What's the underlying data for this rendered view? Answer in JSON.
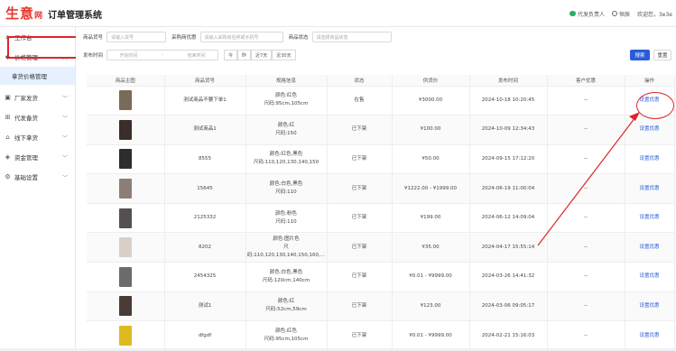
{
  "header": {
    "logo_main": "生意",
    "logo_sub": "网",
    "title": "订单管理系统",
    "agent_label": "代发负责人",
    "account_label": "恒辰",
    "welcome": "欢迎您，3e3e"
  },
  "sidebar": {
    "items": [
      {
        "label": "工作台",
        "icon": "home-icon"
      },
      {
        "label": "价格管理",
        "icon": "tag-icon",
        "expanded": true
      },
      {
        "label": "厂家发货",
        "icon": "box-icon"
      },
      {
        "label": "代发备货",
        "icon": "cart-icon"
      },
      {
        "label": "线下拿货",
        "icon": "store-icon"
      },
      {
        "label": "资金管理",
        "icon": "wallet-icon"
      },
      {
        "label": "基础设置",
        "icon": "gear-icon"
      }
    ],
    "active_sub": "拿货价格管理"
  },
  "filters": {
    "goods_no_label": "商品货号",
    "goods_no_placeholder": "请输入货号",
    "buyer_label": "采购商优惠",
    "buyer_placeholder": "请输入采购商名称或手机号",
    "status_label": "商品状态",
    "status_placeholder": "请选择商品状态",
    "time_label": "发布时间",
    "start_placeholder": "开始时间",
    "end_placeholder": "结束时间",
    "range_sep": "-",
    "quick": [
      "今",
      "昨",
      "近7天",
      "近30天"
    ],
    "search_btn": "搜索",
    "reset_btn": "重置"
  },
  "table": {
    "columns": [
      "商品主图",
      "商品货号",
      "规格信息",
      "状态",
      "供货价",
      "发布时间",
      "客户优惠",
      "操作"
    ],
    "rows": [
      {
        "sku": "测试商品不要下单1",
        "spec1": "颜色:红色",
        "spec2": "尺码:95cm,105cm",
        "status": "在售",
        "price": "¥3000.00",
        "time": "2024-10-18 10:20:45",
        "discount": "--",
        "action": "设置优惠",
        "img": "#7a6a58"
      },
      {
        "sku": "测试商品1",
        "spec1": "颜色:红",
        "spec2": "尺码:150",
        "status": "已下架",
        "price": "¥100.00",
        "time": "2024-10-09 12:34:43",
        "discount": "--",
        "action": "设置优惠",
        "img": "#3a2e2a"
      },
      {
        "sku": "8555",
        "spec1": "颜色:红色,黑色",
        "spec2": "尺码:110,120,130,140,150",
        "status": "已下架",
        "price": "¥50.00",
        "time": "2024-09-15 17:12:20",
        "discount": "--",
        "action": "设置优惠",
        "img": "#2d2d2d"
      },
      {
        "sku": "15645",
        "spec1": "颜色:白色,黑色",
        "spec2": "尺码:110",
        "status": "已下架",
        "price": "¥1222.00 - ¥1999.00",
        "time": "2024-06-19 11:00:04",
        "discount": "--",
        "action": "设置优惠",
        "img": "#8c7f78"
      },
      {
        "sku": "2125332",
        "spec1": "颜色:粉色",
        "spec2": "尺码:110",
        "status": "已下架",
        "price": "¥199.00",
        "time": "2024-06-12 14:09:04",
        "discount": "--",
        "action": "设置优惠",
        "img": "#555050"
      },
      {
        "sku": "8202",
        "spec1": "颜色:图片色",
        "spec2": "尺码:110,120,130,140,150,160,...",
        "status": "已下架",
        "price": "¥35.00",
        "time": "2024-04-17 15:55:14",
        "discount": "--",
        "action": "设置优惠",
        "img": "#d8d0c6"
      },
      {
        "sku": "2454325",
        "spec1": "颜色:白色,黑色",
        "spec2": "尺码:120cm,140cm",
        "status": "已下架",
        "price": "¥0.01 - ¥9999.00",
        "time": "2024-03-26 14:41:32",
        "discount": "--",
        "action": "设置优惠",
        "img": "#6b6b6b"
      },
      {
        "sku": "测试1",
        "spec1": "颜色:红",
        "spec2": "尺码:52cm,59cm",
        "status": "已下架",
        "price": "¥123.00",
        "time": "2024-03-06 09:05:17",
        "discount": "--",
        "action": "设置优惠",
        "img": "#4a3b36"
      },
      {
        "sku": "dfgdf",
        "spec1": "颜色:红色",
        "spec2": "尺码:95cm,105cm",
        "status": "已下架",
        "price": "¥0.01 - ¥9999.00",
        "time": "2024-02-21 15:16:03",
        "discount": "--",
        "action": "设置优惠",
        "img": "#e0b820"
      }
    ]
  },
  "colors": {
    "accent": "#2a5cd7",
    "annotation_red": "#e0242b",
    "brand_red": "#e8372b"
  }
}
